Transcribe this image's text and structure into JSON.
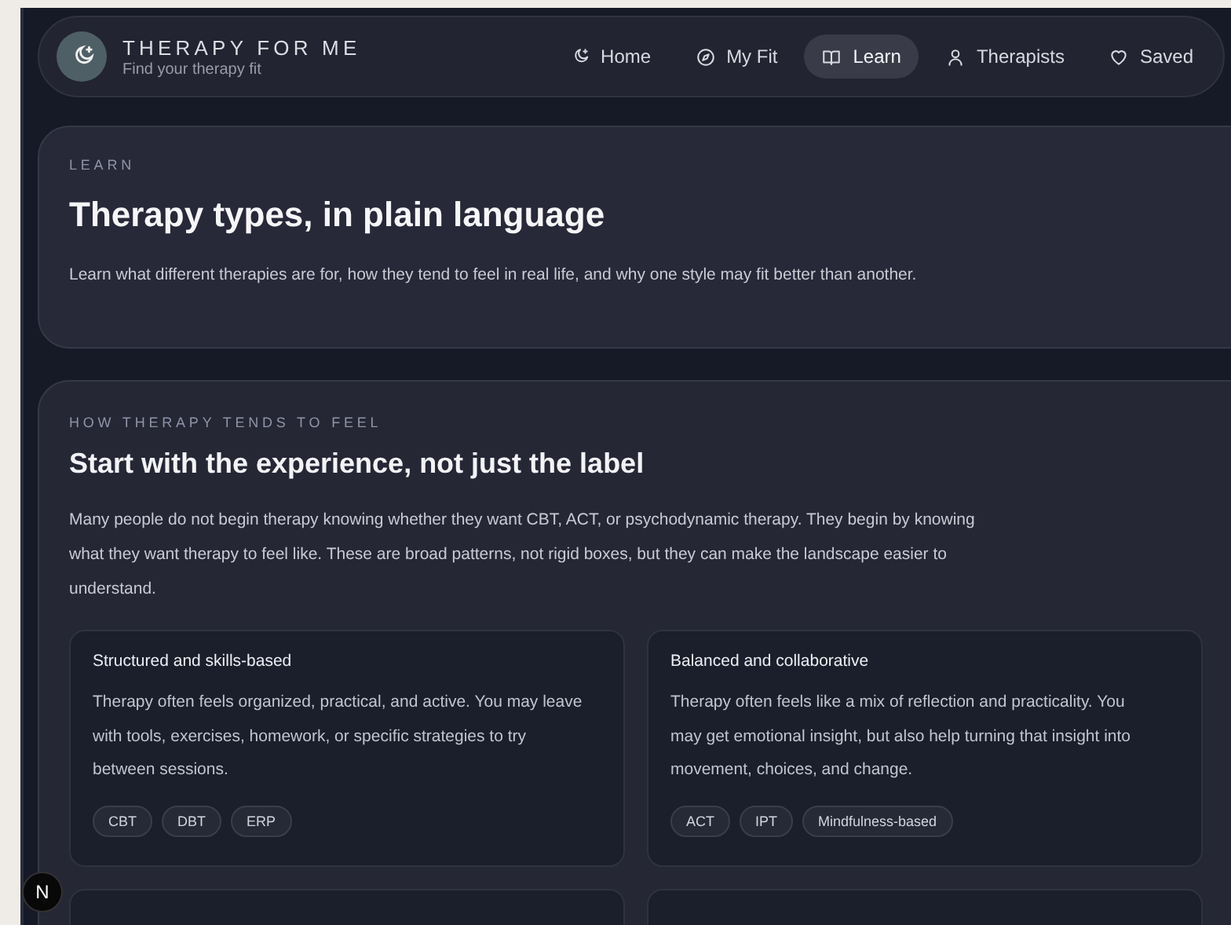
{
  "brand": {
    "title": "THERAPY FOR ME",
    "subtitle": "Find your therapy fit"
  },
  "nav": [
    {
      "label": "Home",
      "kind": "moon",
      "selected": false
    },
    {
      "label": "My Fit",
      "kind": "compass",
      "selected": false
    },
    {
      "label": "Learn",
      "kind": "book",
      "selected": true
    },
    {
      "label": "Therapists",
      "kind": "person",
      "selected": false
    },
    {
      "label": "Saved",
      "kind": "heart",
      "selected": false
    }
  ],
  "intro": {
    "eyebrow": "LEARN",
    "title": "Therapy types, in plain language",
    "text": "Learn what different therapies are for, how they tend to feel in real life, and why one style may fit better than another."
  },
  "section": {
    "eyebrow": "HOW THERAPY TENDS TO FEEL",
    "title": "Start with the experience, not just the label",
    "text": "Many people do not begin therapy knowing whether they want CBT, ACT, or psychodynamic therapy. They begin by knowing what they want therapy to feel like. These are broad patterns, not rigid boxes, but they can make the landscape easier to understand.",
    "cards": [
      {
        "kind": "full",
        "title": "Structured and skills-based",
        "text": "Therapy often feels organized, practical, and active. You may leave with tools, exercises, homework, or specific strategies to try between sessions.",
        "tags": [
          "CBT",
          "DBT",
          "ERP"
        ]
      },
      {
        "kind": "full",
        "title": "Balanced and collaborative",
        "text": "Therapy often feels like a mix of reflection and practicality. You may get emotional insight, but also help turning that insight into movement, choices, and change.",
        "tags": [
          "ACT",
          "IPT",
          "Mindfulness-based"
        ]
      },
      {
        "kind": "cut"
      },
      {
        "kind": "cut"
      }
    ]
  },
  "badge": "N"
}
